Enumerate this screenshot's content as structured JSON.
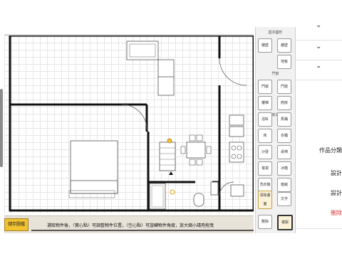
{
  "app": {
    "save_button": "儲存圖檔",
    "hint": "選取物件後，〈實心點〉可調整物件位置，〈空心點〉可旋轉物件角度，放大縮小請用拖曳"
  },
  "palette": {
    "sections": [
      "基本圖形",
      "門窗",
      "家具"
    ],
    "buttons": [
      {
        "label": "牆壁",
        "col": 0,
        "row": 0
      },
      {
        "label": "牆壁",
        "col": 1,
        "row": 0
      },
      {
        "label": "地板",
        "col": 1,
        "row": 1
      },
      {
        "label": "門窗",
        "col": 0,
        "row": 2
      },
      {
        "label": "門窗",
        "col": 1,
        "row": 2
      },
      {
        "label": "樓梯",
        "col": 0,
        "row": 3
      },
      {
        "label": "廚房",
        "col": 1,
        "row": 3
      },
      {
        "label": "浴缸",
        "col": 0,
        "row": 4
      },
      {
        "label": "馬桶",
        "col": 1,
        "row": 4
      },
      {
        "label": "床",
        "col": 0,
        "row": 5
      },
      {
        "label": "衣櫃",
        "col": 1,
        "row": 5
      },
      {
        "label": "沙發",
        "col": 0,
        "row": 6
      },
      {
        "label": "桌椅",
        "col": 1,
        "row": 6
      },
      {
        "label": "電視",
        "col": 0,
        "row": 7
      },
      {
        "label": "冰箱",
        "col": 1,
        "row": 7
      },
      {
        "label": "洗衣機",
        "col": 0,
        "row": 8
      },
      {
        "label": "植栽",
        "col": 1,
        "row": 8
      },
      {
        "label": "文字",
        "col": 0,
        "row": 9
      },
      {
        "label": "圖片",
        "col": 1,
        "row": 9
      }
    ],
    "gold_tall": "清除畫面",
    "bottom": [
      "刪除",
      "複製"
    ]
  },
  "side_panel": {
    "rows": [
      {
        "chevron": "v",
        "label": ""
      },
      {
        "chevron": "v",
        "label": ""
      },
      {
        "chevron": "^",
        "label": ""
      }
    ],
    "items": [
      {
        "label": "作品分類",
        "color": "#222222"
      },
      {
        "label": "設計",
        "color": "#222222"
      },
      {
        "label": "設計",
        "color": "#222222"
      },
      {
        "label": "刪除",
        "color": "#d83a3a"
      }
    ]
  }
}
